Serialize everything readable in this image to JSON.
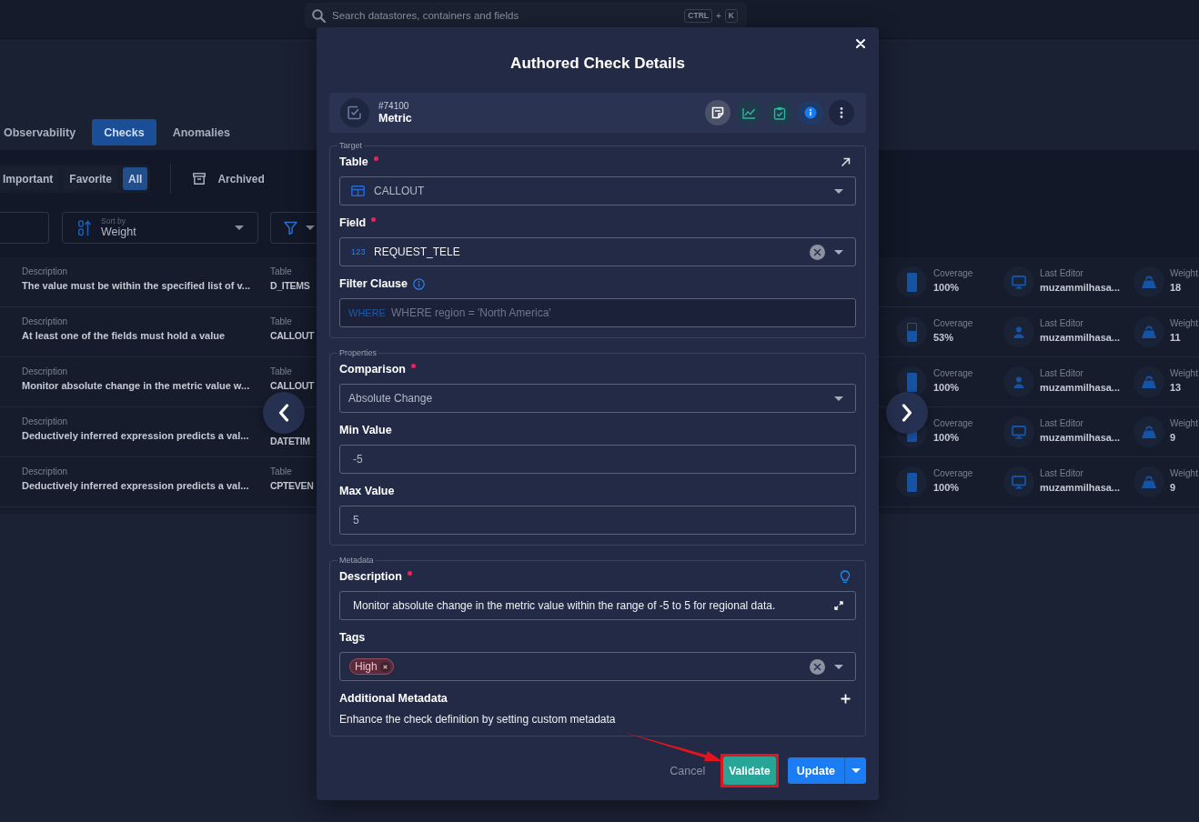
{
  "search": {
    "placeholder": "Search datastores, containers and fields",
    "shortcut_keys": [
      "CTRL",
      "K"
    ],
    "shortcut_joiner": "+"
  },
  "tabs": [
    {
      "label": "Observability",
      "selected": false
    },
    {
      "label": "Checks",
      "selected": true
    },
    {
      "label": "Anomalies",
      "selected": false
    }
  ],
  "filters": [
    {
      "label": "Important",
      "selected": false
    },
    {
      "label": "Favorite",
      "selected": false
    },
    {
      "label": "All",
      "selected": true
    }
  ],
  "archived": {
    "label": "Archived"
  },
  "sort": {
    "caption": "Sort by",
    "value": "Weight"
  },
  "checks": [
    {
      "kind": "system",
      "description_label": "Description",
      "description": "The value must be within the specified list of v...",
      "table_label": "Table",
      "table": "D_ITEMS",
      "coverage_label": "Coverage",
      "coverage": "100%",
      "level": 1,
      "editor_label": "Last Editor",
      "editor": "muzammilhasa...",
      "weight_label": "Weight",
      "weight": "18"
    },
    {
      "kind": "user",
      "description_label": "Description",
      "description": "At least one of the fields must hold a value",
      "table_label": "Table",
      "table": "CALLOUT",
      "coverage_label": "Coverage",
      "coverage": "53%",
      "level": 0.53,
      "editor_label": "Last Editor",
      "editor": "muzammilhasa...",
      "weight_label": "Weight",
      "weight": "11"
    },
    {
      "kind": "user",
      "description_label": "Description",
      "description": "Monitor absolute change in the metric value w...",
      "table_label": "Table",
      "table": "CALLOUT",
      "coverage_label": "Coverage",
      "coverage": "100%",
      "level": 1,
      "editor_label": "Last Editor",
      "editor": "muzammilhasa...",
      "weight_label": "Weight",
      "weight": "13"
    },
    {
      "kind": "system",
      "description_label": "Description",
      "description": "Deductively inferred expression predicts a val...",
      "table": "DATETIM",
      "coverage_label": "Coverage",
      "coverage": "100%",
      "level": 1,
      "editor_label": "Last Editor",
      "editor": "muzammilhasa...",
      "weight_label": "Weight",
      "weight": "9"
    },
    {
      "kind": "system",
      "description_label": "Description",
      "description": "Deductively inferred expression predicts a val...",
      "table_label": "Table",
      "table": "CPTEVEN",
      "coverage_label": "Coverage",
      "coverage": "100%",
      "level": 1,
      "editor_label": "Last Editor",
      "editor": "muzammilhasa...",
      "weight_label": "Weight",
      "weight": "9"
    }
  ],
  "dialog": {
    "title": "Authored Check Details",
    "check": {
      "id": "#74100",
      "type": "Metric"
    },
    "sections": [
      {
        "legend": "Target",
        "fields": [
          {
            "kind": "table",
            "label": "Table",
            "required": true,
            "value": "CALLOUT"
          },
          {
            "kind": "field",
            "label": "Field",
            "required": true,
            "type_badge": "123",
            "value": "REQUEST_TELE"
          },
          {
            "kind": "filter",
            "label": "Filter Clause",
            "required": false,
            "keyword": "WHERE",
            "placeholder": "WHERE region = 'North America'"
          }
        ]
      },
      {
        "legend": "Properties",
        "fields": [
          {
            "kind": "select",
            "label": "Comparison",
            "required": true,
            "value": "Absolute Change"
          },
          {
            "kind": "input",
            "label": "Min Value",
            "required": false,
            "value": "-5"
          },
          {
            "kind": "input",
            "label": "Max Value",
            "required": false,
            "value": "5"
          }
        ]
      },
      {
        "legend": "Metadata",
        "fields": [
          {
            "kind": "description",
            "label": "Description",
            "required": true,
            "value": "Monitor absolute change in the metric value within the range of -5 to 5 for regional data."
          },
          {
            "kind": "tags",
            "label": "Tags",
            "required": false,
            "tags": [
              "High"
            ]
          },
          {
            "kind": "extra",
            "label": "Additional Metadata",
            "required": false,
            "help": "Enhance the check definition by setting custom metadata"
          }
        ]
      }
    ],
    "buttons": [
      {
        "kind": "text",
        "label": "Cancel",
        "highlighted": false
      },
      {
        "kind": "accent",
        "label": "Validate",
        "highlighted": true
      },
      {
        "kind": "split",
        "label": "Update",
        "highlighted": false
      }
    ]
  }
}
